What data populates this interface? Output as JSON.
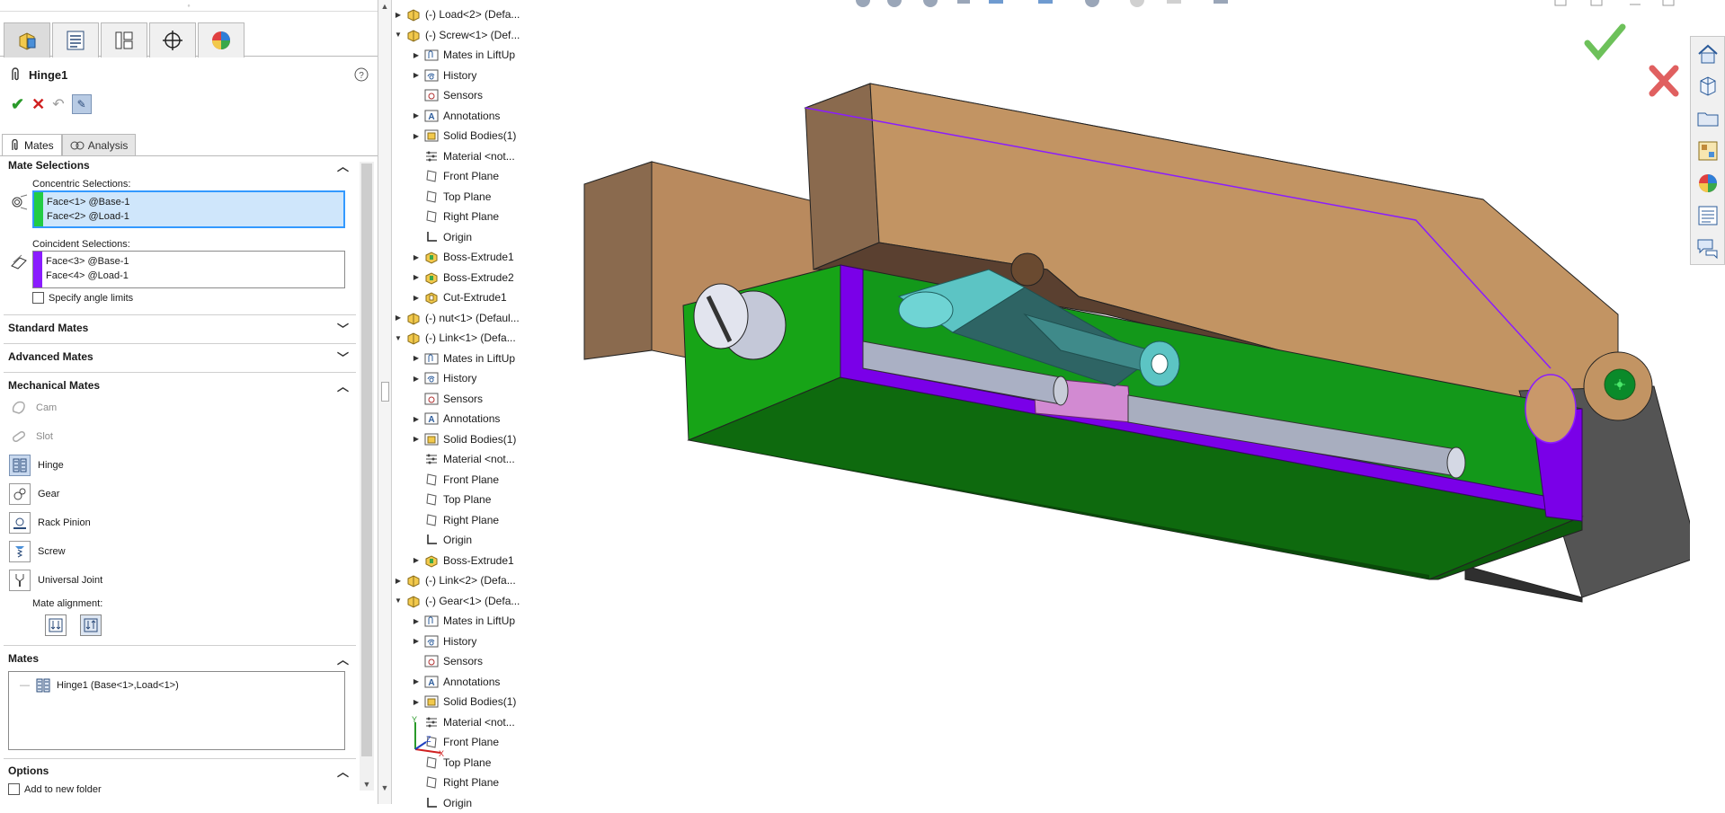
{
  "property_manager": {
    "title": "Hinge1",
    "tabs": [
      "Mates",
      "Analysis"
    ],
    "mate_selections": {
      "header": "Mate Selections",
      "concentric_label": "Concentric Selections:",
      "concentric_items": [
        "Face<1> @Base-1",
        "Face<2> @Load-1"
      ],
      "concentric_color": "#22cc44",
      "coincident_label": "Coincident Selections:",
      "coincident_items": [
        "Face<3> @Base-1",
        "Face<4> @Load-1"
      ],
      "coincident_color": "#8a1cff",
      "angle_limits_label": "Specify angle limits",
      "angle_limits_checked": false
    },
    "standard_mates_header": "Standard Mates",
    "advanced_mates_header": "Advanced Mates",
    "mechanical_mates": {
      "header": "Mechanical Mates",
      "items": [
        {
          "label": "Cam",
          "icon": "cam-icon",
          "enabled": false
        },
        {
          "label": "Slot",
          "icon": "slot-icon",
          "enabled": false
        },
        {
          "label": "Hinge",
          "icon": "hinge-icon",
          "enabled": true
        },
        {
          "label": "Gear",
          "icon": "gear-icon",
          "enabled": true
        },
        {
          "label": "Rack Pinion",
          "icon": "rack-pinion-icon",
          "enabled": true
        },
        {
          "label": "Screw",
          "icon": "screw-icon",
          "enabled": true
        },
        {
          "label": "Universal Joint",
          "icon": "universal-joint-icon",
          "enabled": true
        }
      ],
      "alignment_label": "Mate alignment:"
    },
    "mates": {
      "header": "Mates",
      "items": [
        "Hinge1 (Base<1>,Load<1>)"
      ]
    },
    "options": {
      "header": "Options",
      "add_to_folder_label": "Add to new folder"
    }
  },
  "feature_tree": [
    {
      "label": "(-) Load<2> (Defa...",
      "level": 0,
      "expander": "collapsed",
      "icon": "component-icon"
    },
    {
      "label": "(-) Screw<1> (Def...",
      "level": 0,
      "expander": "expanded",
      "icon": "component-icon"
    },
    {
      "label": "Mates in LiftUp",
      "level": 1,
      "expander": "collapsed",
      "icon": "mates-folder-icon"
    },
    {
      "label": "History",
      "level": 1,
      "expander": "collapsed",
      "icon": "history-icon"
    },
    {
      "label": "Sensors",
      "level": 1,
      "expander": "none",
      "icon": "sensors-icon"
    },
    {
      "label": "Annotations",
      "level": 1,
      "expander": "collapsed",
      "icon": "annotations-icon"
    },
    {
      "label": "Solid Bodies(1)",
      "level": 1,
      "expander": "collapsed",
      "icon": "solid-bodies-icon"
    },
    {
      "label": "Material <not...",
      "level": 1,
      "expander": "none",
      "icon": "material-icon"
    },
    {
      "label": "Front Plane",
      "level": 1,
      "expander": "none",
      "icon": "plane-icon"
    },
    {
      "label": "Top Plane",
      "level": 1,
      "expander": "none",
      "icon": "plane-icon"
    },
    {
      "label": "Right Plane",
      "level": 1,
      "expander": "none",
      "icon": "plane-icon"
    },
    {
      "label": "Origin",
      "level": 1,
      "expander": "none",
      "icon": "origin-icon"
    },
    {
      "label": "Boss-Extrude1",
      "level": 1,
      "expander": "collapsed",
      "icon": "boss-extrude-icon"
    },
    {
      "label": "Boss-Extrude2",
      "level": 1,
      "expander": "collapsed",
      "icon": "boss-extrude-icon"
    },
    {
      "label": "Cut-Extrude1",
      "level": 1,
      "expander": "collapsed",
      "icon": "cut-extrude-icon"
    },
    {
      "label": "(-) nut<1> (Defaul...",
      "level": 0,
      "expander": "collapsed",
      "icon": "component-icon"
    },
    {
      "label": "(-) Link<1> (Defa...",
      "level": 0,
      "expander": "expanded",
      "icon": "component-icon"
    },
    {
      "label": "Mates in LiftUp",
      "level": 1,
      "expander": "collapsed",
      "icon": "mates-folder-icon"
    },
    {
      "label": "History",
      "level": 1,
      "expander": "collapsed",
      "icon": "history-icon"
    },
    {
      "label": "Sensors",
      "level": 1,
      "expander": "none",
      "icon": "sensors-icon"
    },
    {
      "label": "Annotations",
      "level": 1,
      "expander": "collapsed",
      "icon": "annotations-icon"
    },
    {
      "label": "Solid Bodies(1)",
      "level": 1,
      "expander": "collapsed",
      "icon": "solid-bodies-icon"
    },
    {
      "label": "Material <not...",
      "level": 1,
      "expander": "none",
      "icon": "material-icon"
    },
    {
      "label": "Front Plane",
      "level": 1,
      "expander": "none",
      "icon": "plane-icon"
    },
    {
      "label": "Top Plane",
      "level": 1,
      "expander": "none",
      "icon": "plane-icon"
    },
    {
      "label": "Right Plane",
      "level": 1,
      "expander": "none",
      "icon": "plane-icon"
    },
    {
      "label": "Origin",
      "level": 1,
      "expander": "none",
      "icon": "origin-icon"
    },
    {
      "label": "Boss-Extrude1",
      "level": 1,
      "expander": "collapsed",
      "icon": "boss-extrude-icon"
    },
    {
      "label": "(-) Link<2> (Defa...",
      "level": 0,
      "expander": "collapsed",
      "icon": "component-icon"
    },
    {
      "label": "(-) Gear<1> (Defa...",
      "level": 0,
      "expander": "expanded",
      "icon": "component-icon"
    },
    {
      "label": "Mates in LiftUp",
      "level": 1,
      "expander": "collapsed",
      "icon": "mates-folder-icon"
    },
    {
      "label": "History",
      "level": 1,
      "expander": "collapsed",
      "icon": "history-icon"
    },
    {
      "label": "Sensors",
      "level": 1,
      "expander": "none",
      "icon": "sensors-icon"
    },
    {
      "label": "Annotations",
      "level": 1,
      "expander": "collapsed",
      "icon": "annotations-icon"
    },
    {
      "label": "Solid Bodies(1)",
      "level": 1,
      "expander": "collapsed",
      "icon": "solid-bodies-icon"
    },
    {
      "label": "Material <not...",
      "level": 1,
      "expander": "none",
      "icon": "material-icon"
    },
    {
      "label": "Front Plane",
      "level": 1,
      "expander": "none",
      "icon": "plane-icon"
    },
    {
      "label": "Top Plane",
      "level": 1,
      "expander": "none",
      "icon": "plane-icon"
    },
    {
      "label": "Right Plane",
      "level": 1,
      "expander": "none",
      "icon": "plane-icon"
    },
    {
      "label": "Origin",
      "level": 1,
      "expander": "none",
      "icon": "origin-icon"
    }
  ],
  "colors": {
    "brown": "#c09060",
    "dark_brown": "#5a4030",
    "green": "#00a000",
    "purple": "#7a00e8",
    "teal": "#5cc4c4",
    "steel": "#b0b4c4",
    "gray": "#505050",
    "accept_green": "#5cbf4a",
    "cancel_red": "#e04848"
  }
}
